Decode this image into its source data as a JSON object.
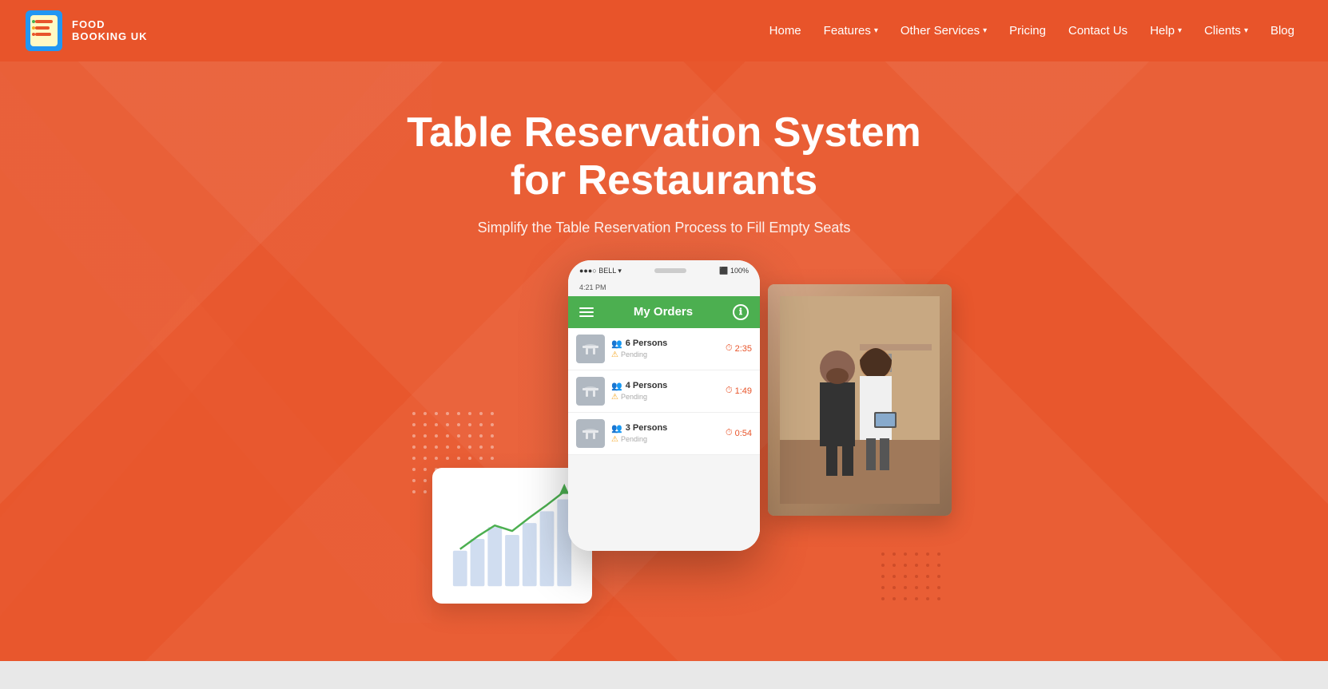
{
  "navbar": {
    "logo_line1": "FOOD",
    "logo_line2": "BOOKING UK",
    "links": [
      {
        "label": "Home",
        "has_arrow": false
      },
      {
        "label": "Features",
        "has_arrow": true
      },
      {
        "label": "Other Services",
        "has_arrow": true
      },
      {
        "label": "Pricing",
        "has_arrow": false
      },
      {
        "label": "Contact Us",
        "has_arrow": false
      },
      {
        "label": "Help",
        "has_arrow": true
      },
      {
        "label": "Clients",
        "has_arrow": true
      },
      {
        "label": "Blog",
        "has_arrow": false
      }
    ]
  },
  "hero": {
    "title_line1": "Table Reservation System",
    "title_line2": "for Restaurants",
    "subtitle": "Simplify the Table Reservation Process to Fill Empty Seats"
  },
  "phone": {
    "status_left": "●●●○○ BELL ▾",
    "status_time": "4:21 PM",
    "status_right": "◼ 100%",
    "header_title": "My Orders",
    "orders": [
      {
        "persons": "6 Persons",
        "status": "Pending",
        "time": "2:35"
      },
      {
        "persons": "4 Persons",
        "status": "Pending",
        "time": "1:49"
      },
      {
        "persons": "3 Persons",
        "status": "Pending",
        "time": "0:54"
      }
    ]
  },
  "colors": {
    "hero_bg": "#e8572d",
    "navbar_bg": "#e8542a",
    "green": "#4caf50",
    "chart_line": "#4caf50",
    "chart_bars": "#c8d8f0",
    "timer_icon": "#e8542a"
  }
}
